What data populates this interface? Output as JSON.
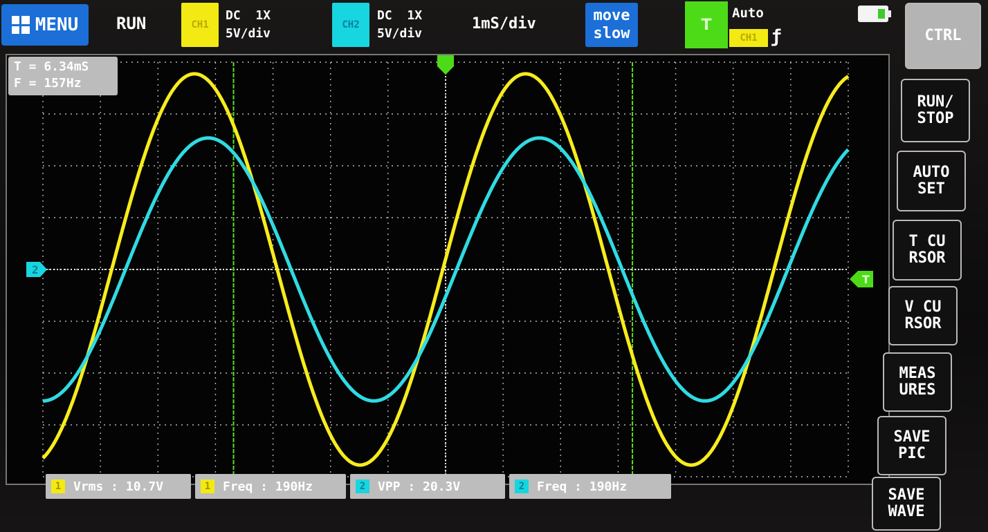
{
  "header": {
    "menu_label": "MENU",
    "run_state": "RUN",
    "ch1": {
      "badge": "CH1",
      "coupling": "DC",
      "probe": "1X",
      "scale": "5V/div",
      "color": "#f2ea12"
    },
    "ch2": {
      "badge": "CH2",
      "coupling": "DC",
      "probe": "1X",
      "scale": "5V/div",
      "color": "#17d6df"
    },
    "timebase": "1mS/div",
    "move_line1": "move",
    "move_line2": "slow",
    "trigger": {
      "badge": "T",
      "mode": "Auto",
      "source": "CH1",
      "edge": "ƒ",
      "color": "#4ddb18"
    }
  },
  "cursor_readout": {
    "period": "T = 6.34mS",
    "frequency": "F = 157Hz"
  },
  "sidebar": {
    "ctrl": "CTRL",
    "run_stop": "RUN/\nSTOP",
    "auto_set": "AUTO\nSET",
    "t_cursor": "T  CU\nRSOR",
    "v_cursor": "V  CU\nRSOR",
    "measures": "MEAS\nURES",
    "save_pic": "SAVE\nPIC",
    "save_wave": "SAVE\nWAVE"
  },
  "measurements": [
    {
      "channel": "1",
      "text": "Vrms : 10.7V"
    },
    {
      "channel": "1",
      "text": "Freq : 190Hz"
    },
    {
      "channel": "2",
      "text": "VPP  : 20.3V"
    },
    {
      "channel": "2",
      "text": "Freq : 190Hz"
    }
  ],
  "markers": {
    "ch2_level": "2",
    "trigger_level": "T"
  },
  "chart_data": {
    "type": "line",
    "xlim": [
      -6.4,
      6.4
    ],
    "ylim": [
      -16,
      16
    ],
    "series": [
      {
        "amplitude": 15.1,
        "frequency_khz": 0.19,
        "phase_deg": 3,
        "offset": 0,
        "color": "#f7ec1c"
      },
      {
        "amplitude": 10.15,
        "frequency_khz": 0.19,
        "phase_deg": -12,
        "offset": 0,
        "color": "#2fdbe3"
      }
    ],
    "cursors_x": [
      -3.37,
      2.97
    ],
    "trigger_offset": 0
  }
}
